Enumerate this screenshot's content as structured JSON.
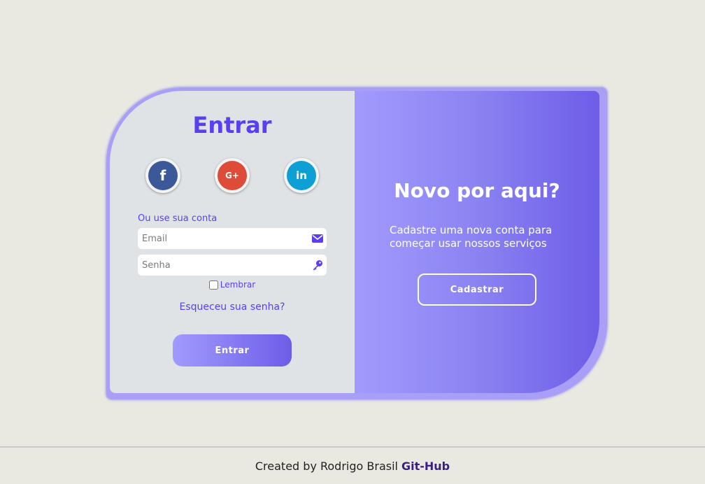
{
  "login": {
    "title": "Entrar",
    "social": {
      "facebook_glyph": "f",
      "google_glyph": "G+",
      "linkedin_glyph": "in"
    },
    "alt_label": "Ou use sua conta",
    "email_placeholder": "Email",
    "password_placeholder": "Senha",
    "remember_label": "Lembrar",
    "forgot_link": "Esqueceu sua senha?",
    "submit_label": "Entrar"
  },
  "signup": {
    "title": "Novo por aqui?",
    "text": "Cadastre uma nova conta para começar usar nossos serviços",
    "button_label": "Cadastrar"
  },
  "footer": {
    "text": "Created by Rodrigo Brasil",
    "link": "Git-Hub"
  },
  "colors": {
    "accent": "#5a3ff0",
    "gradient_start": "#a19bfd",
    "gradient_end": "#6d5de8",
    "facebook": "#3b5998",
    "google": "#dd4b39",
    "linkedin": "#0e9fd4"
  },
  "icons": {
    "email_field": "envelope-icon",
    "password_field": "key-icon"
  }
}
